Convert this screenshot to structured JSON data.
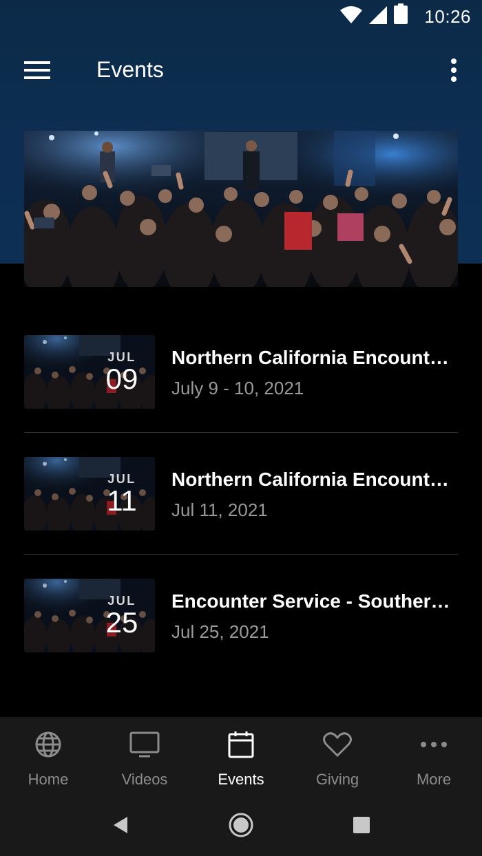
{
  "status": {
    "time": "10:26"
  },
  "appbar": {
    "title": "Events"
  },
  "events": [
    {
      "month": "JUL",
      "day": "09",
      "title": "Northern California Encounter...",
      "date": "July 9 - 10, 2021"
    },
    {
      "month": "JUL",
      "day": "11",
      "title": "Northern California Encounter...",
      "date": "Jul 11, 2021"
    },
    {
      "month": "JUL",
      "day": "25",
      "title": "Encounter Service - Southern...",
      "date": "Jul 25, 2021"
    }
  ],
  "nav": {
    "items": [
      {
        "label": "Home",
        "icon": "globe-icon"
      },
      {
        "label": "Videos",
        "icon": "tv-icon"
      },
      {
        "label": "Events",
        "icon": "calendar-icon"
      },
      {
        "label": "Giving",
        "icon": "heart-icon"
      },
      {
        "label": "More",
        "icon": "dots-horizontal-icon"
      }
    ],
    "active": "Events"
  },
  "colors": {
    "appbar_bg": "#0d2e52",
    "page_bg": "#000000",
    "nav_bg": "#191919",
    "muted_text": "#9a9a9a"
  }
}
